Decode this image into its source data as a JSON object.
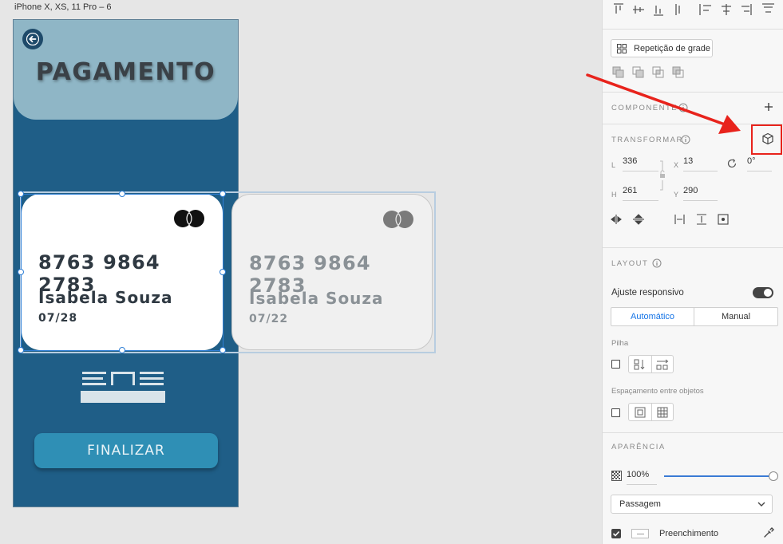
{
  "artboard": {
    "title": "iPhone X, XS, 11 Pro – 6",
    "page_title": "PAGAMENTO",
    "finish_label": "FINALIZAR"
  },
  "cards": [
    {
      "number": "8763 9864 2783",
      "holder": "Isabela Souza",
      "expiry": "07/28"
    },
    {
      "number": "8763 9864 2783",
      "holder": "Isabela Souza",
      "expiry": "07/22"
    }
  ],
  "panel": {
    "repeat_grid_label": "Repetição de grade",
    "component_label": "COMPONENTE",
    "transform_label": "TRANSFORMAR",
    "transform": {
      "width_label": "L",
      "width": "336",
      "height_label": "H",
      "height": "261",
      "x_label": "X",
      "x": "13",
      "y_label": "Y",
      "y": "290",
      "rotation": "0°"
    },
    "layout_label": "LAYOUT",
    "responsive_label": "Ajuste responsivo",
    "responsive_on": true,
    "tabs": [
      "Automático",
      "Manual"
    ],
    "stack_label": "Pilha",
    "spacing_label": "Espaçamento entre objetos",
    "appearance_label": "APARÊNCIA",
    "opacity": "100%",
    "blend_mode": "Passagem",
    "fill_label": "Preenchimento"
  },
  "colors": {
    "artboard_bg": "#1f5e87",
    "header_bg": "#8fb6c6",
    "finish_bg": "#2f8fb5",
    "accent": "#2f7fd6",
    "annotation": "#e8231c"
  }
}
